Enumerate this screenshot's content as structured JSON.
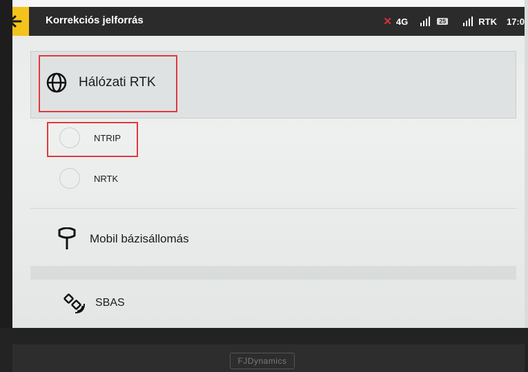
{
  "header": {
    "title": "Korrekciós jelforrás"
  },
  "status": {
    "network": "4G",
    "satellites": "25",
    "rtk": "RTK",
    "time": "17:0"
  },
  "sections": {
    "network_rtk": "Hálózati RTK",
    "options": [
      "NTRIP",
      "NRTK"
    ],
    "mobile_base": "Mobil bázisállomás",
    "sbas": "SBAS"
  },
  "footer": {
    "brand": "FJDynamics"
  },
  "colors": {
    "accent": "#f3c21b",
    "highlight": "#e0393e",
    "status_bar": "#2b2b2b"
  },
  "icons": [
    "back-arrow-icon",
    "globe-icon",
    "antenna-icon",
    "satellite-icon",
    "signal-icon"
  ]
}
